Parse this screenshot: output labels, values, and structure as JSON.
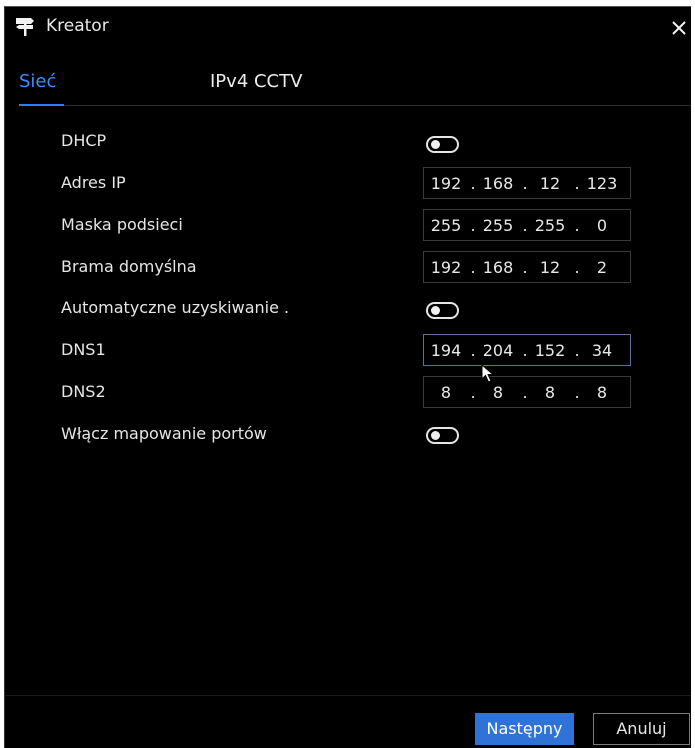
{
  "window": {
    "title": "Kreator",
    "icon": "signpost-icon",
    "close_icon": "close-icon"
  },
  "tabs": [
    {
      "label": "Sieć",
      "active": true
    },
    {
      "label": "IPv4 CCTV",
      "active": false
    }
  ],
  "fields": {
    "dhcp": {
      "label": "DHCP",
      "enabled": false
    },
    "ip_address": {
      "label": "Adres IP",
      "octets": [
        "192",
        "168",
        "12",
        "123"
      ]
    },
    "subnet_mask": {
      "label": "Maska podsieci",
      "octets": [
        "255",
        "255",
        "255",
        "0"
      ]
    },
    "gateway": {
      "label": "Brama domyślna",
      "octets": [
        "192",
        "168",
        "12",
        "2"
      ]
    },
    "auto_dns": {
      "label": "Automatyczne uzyskiwanie .",
      "enabled": false
    },
    "dns1": {
      "label": "DNS1",
      "octets": [
        "194",
        "204",
        "152",
        "34"
      ]
    },
    "dns2": {
      "label": "DNS2",
      "octets": [
        "8",
        "8",
        "8",
        "8"
      ]
    },
    "port_mapping": {
      "label": "Włącz mapowanie portów",
      "enabled": false
    }
  },
  "buttons": {
    "next": "Następny",
    "cancel": "Anuluj"
  },
  "colors": {
    "accent": "#2f73d9",
    "active_tab": "#3d8bff",
    "background": "#000000"
  }
}
